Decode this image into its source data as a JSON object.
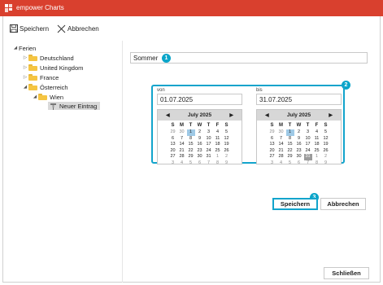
{
  "window": {
    "title": "empower Charts"
  },
  "toolbar": {
    "save_label": "Speichern",
    "cancel_label": "Abbrechen"
  },
  "tree": {
    "items": [
      {
        "label": "Ferien",
        "arrow": "◢",
        "folder": false,
        "level": 0
      },
      {
        "label": "Deutschland",
        "arrow": "▷",
        "folder": true,
        "level": 1
      },
      {
        "label": "United Kingdom",
        "arrow": "▷",
        "folder": true,
        "level": 1
      },
      {
        "label": "France",
        "arrow": "▷",
        "folder": true,
        "level": 1
      },
      {
        "label": "Österreich",
        "arrow": "◢",
        "folder": true,
        "level": 1
      },
      {
        "label": "Wien",
        "arrow": "◢",
        "folder": true,
        "level": 2
      },
      {
        "label": "Neuer Eintrag",
        "arrow": "",
        "folder": false,
        "level": 3,
        "selected": true
      }
    ]
  },
  "form": {
    "name_value": "Sommer",
    "from": {
      "label": "von",
      "value": "01.07.2025",
      "month_label": "July 2025",
      "selected_day": "1"
    },
    "to": {
      "label": "bis",
      "value": "31.07.2025",
      "month_label": "July 2025",
      "selected_day": "31",
      "highlighted_day": "1"
    },
    "weekdays": [
      "S",
      "M",
      "T",
      "W",
      "T",
      "F",
      "S"
    ],
    "weeks": [
      [
        "29",
        "30",
        "1",
        "2",
        "3",
        "4",
        "5"
      ],
      [
        "6",
        "7",
        "8",
        "9",
        "10",
        "11",
        "12"
      ],
      [
        "13",
        "14",
        "15",
        "16",
        "17",
        "18",
        "19"
      ],
      [
        "20",
        "21",
        "22",
        "23",
        "24",
        "25",
        "26"
      ],
      [
        "27",
        "28",
        "29",
        "30",
        "31",
        "1",
        "2"
      ],
      [
        "3",
        "4",
        "5",
        "6",
        "7",
        "8",
        "9"
      ]
    ],
    "save_label": "Speichern",
    "cancel_label": "Abbrechen"
  },
  "badges": [
    "1",
    "2",
    "3"
  ],
  "footer": {
    "close_label": "Schließen"
  },
  "colors": {
    "titlebar": "#d9402e",
    "accent": "#12a4cc",
    "folder": "#f5c542",
    "calendar_selected": "#9ec9e6",
    "calendar_today": "#9b9b9b"
  }
}
